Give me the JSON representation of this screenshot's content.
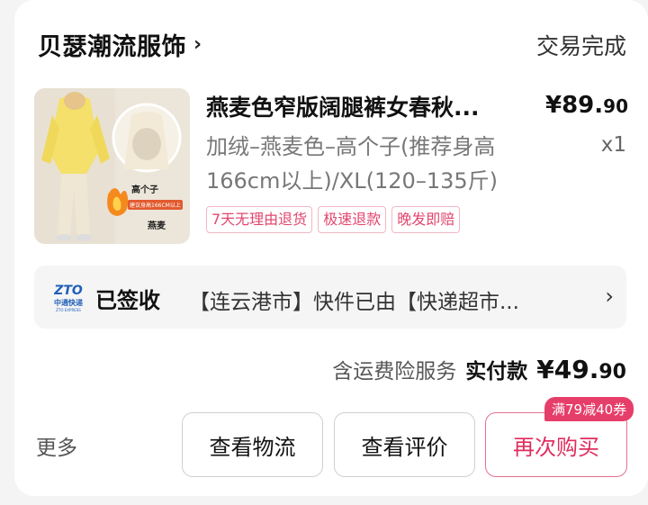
{
  "shop": {
    "name": "贝瑟潮流服饰",
    "status": "交易完成"
  },
  "product": {
    "title": "燕麦色窄版阔腿裤女春秋...",
    "price_int": "¥89.",
    "price_dec": "90",
    "spec": "加绒–燕麦色–高个子(推荐身高166cm以上)/XL(120–135斤)",
    "qty": "x1",
    "image_text_1": "高个子",
    "image_text_2": "建议身高166CM以上",
    "image_text_3": "燕麦",
    "tags": [
      "7天无理由退货",
      "极速退款",
      "晚发即赔"
    ]
  },
  "logistics": {
    "carrier_logo": "ZTO",
    "carrier_logo_sub": "中通快递",
    "carrier_logo_en": "ZTO EXPRESS",
    "status": "已签收",
    "detail": "【连云港市】快件已由【快递超市..."
  },
  "payment": {
    "insurance": "含运费险服务",
    "actual_label": "实付款",
    "actual_int": "¥49.",
    "actual_dec": "90"
  },
  "actions": {
    "more": "更多",
    "view_logistics": "查看物流",
    "view_review": "查看评价",
    "rebuy": "再次购买",
    "promo": "满79减40券"
  },
  "colors": {
    "accent": "#e02d5e",
    "tag_border": "#f1b7c4",
    "zto_blue": "#1f5fb8"
  }
}
